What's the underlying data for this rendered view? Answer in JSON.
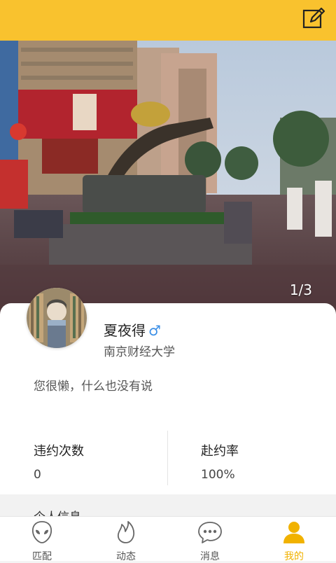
{
  "hero": {
    "pager": "1/3"
  },
  "profile": {
    "name": "夏夜得",
    "gender_symbol": "♂",
    "school": "南京财经大学",
    "bio": "您很懒，什么也没有说"
  },
  "stats": {
    "violations_label": "违约次数",
    "violations_value": "0",
    "attendance_label": "赴约率",
    "attendance_value": "100%"
  },
  "section": {
    "title": "个人信息"
  },
  "nav": {
    "items": [
      {
        "label": "匹配",
        "icon": "alien-icon"
      },
      {
        "label": "动态",
        "icon": "flame-icon"
      },
      {
        "label": "消息",
        "icon": "chat-bubble-icon"
      },
      {
        "label": "我的",
        "icon": "person-icon",
        "active": true
      }
    ]
  },
  "colors": {
    "accent": "#f9c22e",
    "active_nav": "#f1b200",
    "gender": "#3a8ee6"
  }
}
